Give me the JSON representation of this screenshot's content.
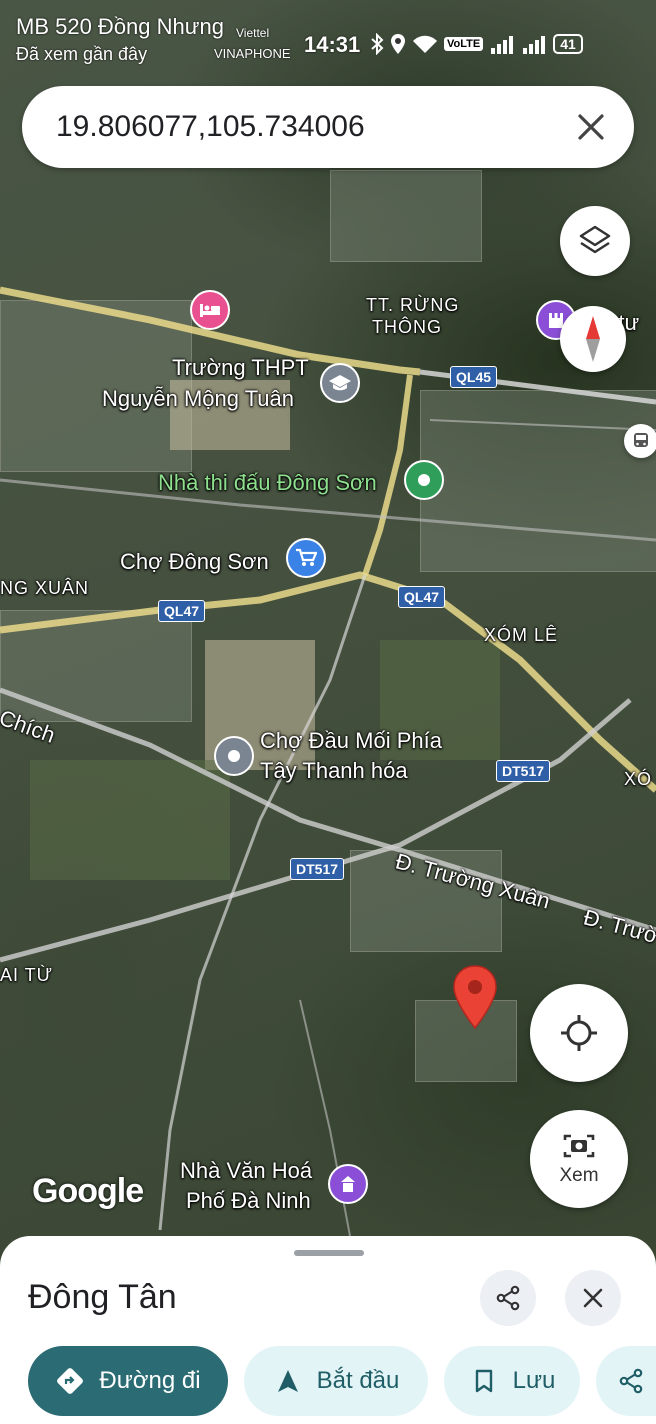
{
  "status_bar": {
    "recent_title": "MB 520 Đồng Nhưng",
    "recent_sub": "Đã xem gần đây",
    "carrier_1": "Viettel",
    "carrier_2": "VINAPHONE",
    "time": "14:31",
    "volte": "VoLTE",
    "battery": "41"
  },
  "search": {
    "query": "19.806077,105.734006"
  },
  "map": {
    "labels": {
      "rung_thong_1": "TT. RỪNG",
      "rung_thong_2": "THÔNG",
      "truong_1": "Trường THPT",
      "truong_2": "Nguyễn Mộng Tuân",
      "nha_thi_dau": "Nhà thi đấu Đông Sơn",
      "cho_dong_son": "Chợ Đông Sơn",
      "ng_xuan": "NG XUÂN",
      "xom_le": "XÓM LÊ",
      "chich": "Chích",
      "cho_dau_1": "Chợ Đầu Mối Phía",
      "cho_dau_2": "Tây Thanh hóa",
      "truong_xuan": "Đ. Trường Xuân",
      "truong_xuan_2": "Đ. Trườ",
      "ai_tu": "AI TỪ",
      "xo": "XÓ",
      "u_tu": "u tư",
      "nha_van_hoa_1": "Nhà Văn Hoá",
      "nha_van_hoa_2": "Phố Đà Ninh"
    },
    "roads": {
      "ql45": "QL45",
      "ql47_a": "QL47",
      "ql47_b": "QL47",
      "dt517_a": "DT517",
      "dt517_b": "DT517"
    },
    "logo": "Google",
    "view_label": "Xem"
  },
  "place_sheet": {
    "title": "Đông Tân",
    "actions": {
      "directions": "Đường đi",
      "start": "Bắt đầu",
      "save": "Lưu"
    }
  },
  "colors": {
    "directions_bg": "#2b6b73",
    "chip_bg": "#e3f4f6",
    "chip_text": "#1f5e66",
    "pin_red": "#ea4335",
    "road_tag": "#2f5fa7"
  }
}
